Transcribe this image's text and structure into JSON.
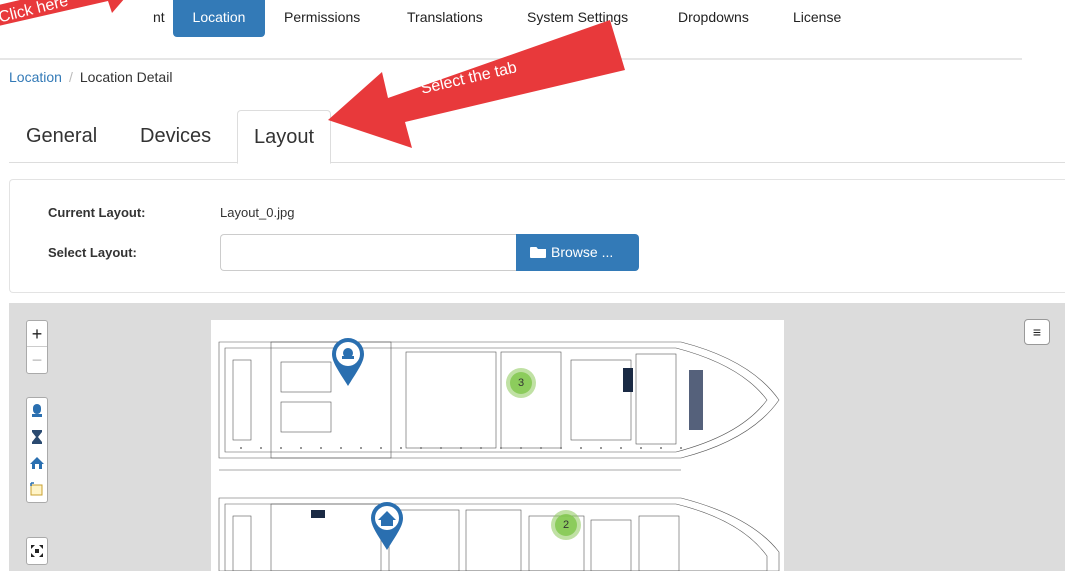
{
  "nav": {
    "items": [
      "nt",
      "Location",
      "Permissions",
      "Translations",
      "System Settings",
      "Dropdowns",
      "License"
    ],
    "active": "Location"
  },
  "breadcrumb": {
    "parent": "Location",
    "separator": "/",
    "current": "Location Detail"
  },
  "subtabs": [
    "General",
    "Devices",
    "Layout"
  ],
  "form": {
    "current_label": "Current Layout:",
    "current_value": "Layout_0.jpg",
    "select_label": "Select Layout:",
    "select_value": "",
    "browse_label": "Browse ..."
  },
  "map": {
    "zoom_in": "+",
    "zoom_out": "−",
    "menu": "≡",
    "clusters": [
      "3",
      "2"
    ],
    "tools": [
      "sensor-icon",
      "hourglass-icon",
      "home-wifi-icon",
      "new-shape-icon",
      "fullscreen-icon"
    ]
  },
  "annotations": {
    "click_here": "Click here",
    "select_tab": "Select the tab"
  },
  "colors": {
    "primary": "#337ab7",
    "arrow": "#e8393b",
    "map_bg": "#dcdcdc",
    "cluster": "#8cc85a"
  }
}
